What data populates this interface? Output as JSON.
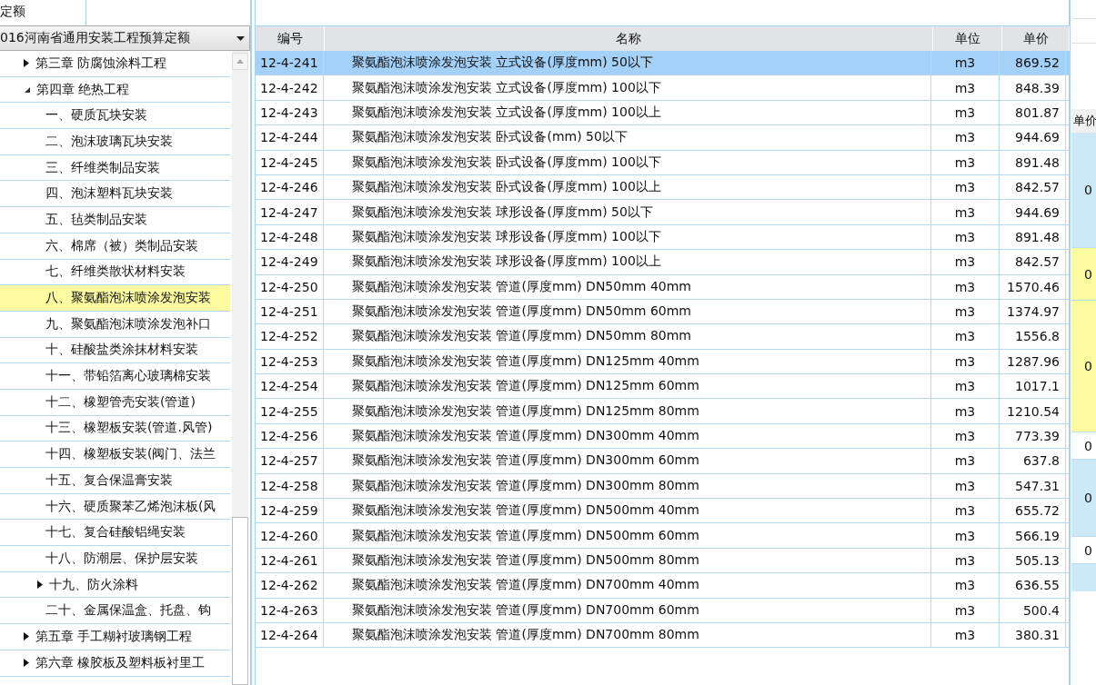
{
  "tab": {
    "label": "定额",
    "selected": true
  },
  "library_select": {
    "value": "016河南省通用安装工程预算定额"
  },
  "tree": [
    {
      "label": "第三章 防腐蚀涂料工程",
      "expanded": false,
      "selected": false
    },
    {
      "label": "第四章 绝热工程",
      "expanded": true,
      "selected": false,
      "children": [
        {
          "label": "一、硬质瓦块安装",
          "selected": false
        },
        {
          "label": "二、泡沫玻璃瓦块安装",
          "selected": false
        },
        {
          "label": "三、纤维类制品安装",
          "selected": false
        },
        {
          "label": "四、泡沫塑料瓦块安装",
          "selected": false
        },
        {
          "label": "五、毡类制品安装",
          "selected": false
        },
        {
          "label": "六、棉席（被）类制品安装",
          "selected": false
        },
        {
          "label": "七、纤维类散状材料安装",
          "selected": false
        },
        {
          "label": "八、聚氨酯泡沫喷涂发泡安装",
          "selected": true
        },
        {
          "label": "九、聚氨酯泡沫喷涂发泡补口",
          "selected": false
        },
        {
          "label": "十、硅酸盐类涂抹材料安装",
          "selected": false
        },
        {
          "label": "十一、带铅箔离心玻璃棉安装",
          "selected": false
        },
        {
          "label": "十二、橡塑管壳安装(管道)",
          "selected": false
        },
        {
          "label": "十三、橡塑板安装(管道.风管)",
          "selected": false
        },
        {
          "label": "十四、橡塑板安装(阀门、法兰",
          "selected": false
        },
        {
          "label": "十五、复合保温膏安装",
          "selected": false
        },
        {
          "label": "十六、硬质聚苯乙烯泡沫板(风",
          "selected": false
        },
        {
          "label": "十七、复合硅酸铝绳安装",
          "selected": false
        },
        {
          "label": "十八、防潮层、保护层安装",
          "selected": false
        },
        {
          "label": "十九、防火涂料",
          "expanded": false,
          "selected": false
        },
        {
          "label": "二十、金属保温盒、托盘、钩",
          "selected": false
        }
      ]
    },
    {
      "label": "第五章 手工糊衬玻璃钢工程",
      "expanded": false,
      "selected": false
    },
    {
      "label": "第六章 橡胶板及塑料板衬里工",
      "expanded": false,
      "selected": false
    }
  ],
  "table": {
    "columns": [
      "编号",
      "名称",
      "单位",
      "单价"
    ],
    "rows": [
      {
        "code": "12-4-241",
        "name": "聚氨酯泡沫喷涂发泡安装 立式设备(厚度mm) 50以下",
        "unit": "m3",
        "price": "869.52",
        "selected": true
      },
      {
        "code": "12-4-242",
        "name": "聚氨酯泡沫喷涂发泡安装 立式设备(厚度mm) 100以下",
        "unit": "m3",
        "price": "848.39",
        "selected": false
      },
      {
        "code": "12-4-243",
        "name": "聚氨酯泡沫喷涂发泡安装 立式设备(厚度mm) 100以上",
        "unit": "m3",
        "price": "801.87",
        "selected": false
      },
      {
        "code": "12-4-244",
        "name": "聚氨酯泡沫喷涂发泡安装 卧式设备(mm) 50以下",
        "unit": "m3",
        "price": "944.69",
        "selected": false
      },
      {
        "code": "12-4-245",
        "name": "聚氨酯泡沫喷涂发泡安装 卧式设备(厚度mm) 100以下",
        "unit": "m3",
        "price": "891.48",
        "selected": false
      },
      {
        "code": "12-4-246",
        "name": "聚氨酯泡沫喷涂发泡安装 卧式设备(厚度mm) 100以上",
        "unit": "m3",
        "price": "842.57",
        "selected": false
      },
      {
        "code": "12-4-247",
        "name": "聚氨酯泡沫喷涂发泡安装 球形设备(厚度mm) 50以下",
        "unit": "m3",
        "price": "944.69",
        "selected": false
      },
      {
        "code": "12-4-248",
        "name": "聚氨酯泡沫喷涂发泡安装 球形设备(厚度mm) 100以下",
        "unit": "m3",
        "price": "891.48",
        "selected": false
      },
      {
        "code": "12-4-249",
        "name": "聚氨酯泡沫喷涂发泡安装 球形设备(厚度mm) 100以上",
        "unit": "m3",
        "price": "842.57",
        "selected": false
      },
      {
        "code": "12-4-250",
        "name": "聚氨酯泡沫喷涂发泡安装 管道(厚度mm) DN50mm 40mm",
        "unit": "m3",
        "price": "1570.46",
        "selected": false
      },
      {
        "code": "12-4-251",
        "name": "聚氨酯泡沫喷涂发泡安装 管道(厚度mm) DN50mm 60mm",
        "unit": "m3",
        "price": "1374.97",
        "selected": false
      },
      {
        "code": "12-4-252",
        "name": "聚氨酯泡沫喷涂发泡安装 管道(厚度mm) DN50mm 80mm",
        "unit": "m3",
        "price": "1556.8",
        "selected": false
      },
      {
        "code": "12-4-253",
        "name": "聚氨酯泡沫喷涂发泡安装 管道(厚度mm) DN125mm 40mm",
        "unit": "m3",
        "price": "1287.96",
        "selected": false
      },
      {
        "code": "12-4-254",
        "name": "聚氨酯泡沫喷涂发泡安装 管道(厚度mm) DN125mm 60mm",
        "unit": "m3",
        "price": "1017.1",
        "selected": false
      },
      {
        "code": "12-4-255",
        "name": "聚氨酯泡沫喷涂发泡安装 管道(厚度mm) DN125mm 80mm",
        "unit": "m3",
        "price": "1210.54",
        "selected": false
      },
      {
        "code": "12-4-256",
        "name": "聚氨酯泡沫喷涂发泡安装 管道(厚度mm) DN300mm 40mm",
        "unit": "m3",
        "price": "773.39",
        "selected": false
      },
      {
        "code": "12-4-257",
        "name": "聚氨酯泡沫喷涂发泡安装 管道(厚度mm) DN300mm 60mm",
        "unit": "m3",
        "price": "637.8",
        "selected": false
      },
      {
        "code": "12-4-258",
        "name": "聚氨酯泡沫喷涂发泡安装 管道(厚度mm) DN300mm 80mm",
        "unit": "m3",
        "price": "547.31",
        "selected": false
      },
      {
        "code": "12-4-259",
        "name": "聚氨酯泡沫喷涂发泡安装 管道(厚度mm) DN500mm 40mm",
        "unit": "m3",
        "price": "655.72",
        "selected": false
      },
      {
        "code": "12-4-260",
        "name": "聚氨酯泡沫喷涂发泡安装 管道(厚度mm) DN500mm 60mm",
        "unit": "m3",
        "price": "566.19",
        "selected": false
      },
      {
        "code": "12-4-261",
        "name": "聚氨酯泡沫喷涂发泡安装 管道(厚度mm) DN500mm 80mm",
        "unit": "m3",
        "price": "505.13",
        "selected": false
      },
      {
        "code": "12-4-262",
        "name": "聚氨酯泡沫喷涂发泡安装 管道(厚度mm) DN700mm 40mm",
        "unit": "m3",
        "price": "636.55",
        "selected": false
      },
      {
        "code": "12-4-263",
        "name": "聚氨酯泡沫喷涂发泡安装 管道(厚度mm) DN700mm 60mm",
        "unit": "m3",
        "price": "500.4",
        "selected": false
      },
      {
        "code": "12-4-264",
        "name": "聚氨酯泡沫喷涂发泡安装 管道(厚度mm) DN700mm 80mm",
        "unit": "m3",
        "price": "380.31",
        "selected": false
      }
    ]
  },
  "side_panel": {
    "header": "单价",
    "cells": [
      {
        "text": "0",
        "color": "#cde8f6"
      },
      {
        "text": "0",
        "color": "#fdfb9f"
      },
      {
        "text": "0",
        "color": "#fdfb9f"
      },
      {
        "text": "0",
        "color": "#ffffff"
      },
      {
        "text": "0",
        "color": "#cde8f6"
      },
      {
        "text": "0",
        "color": "#ffffff"
      }
    ]
  }
}
